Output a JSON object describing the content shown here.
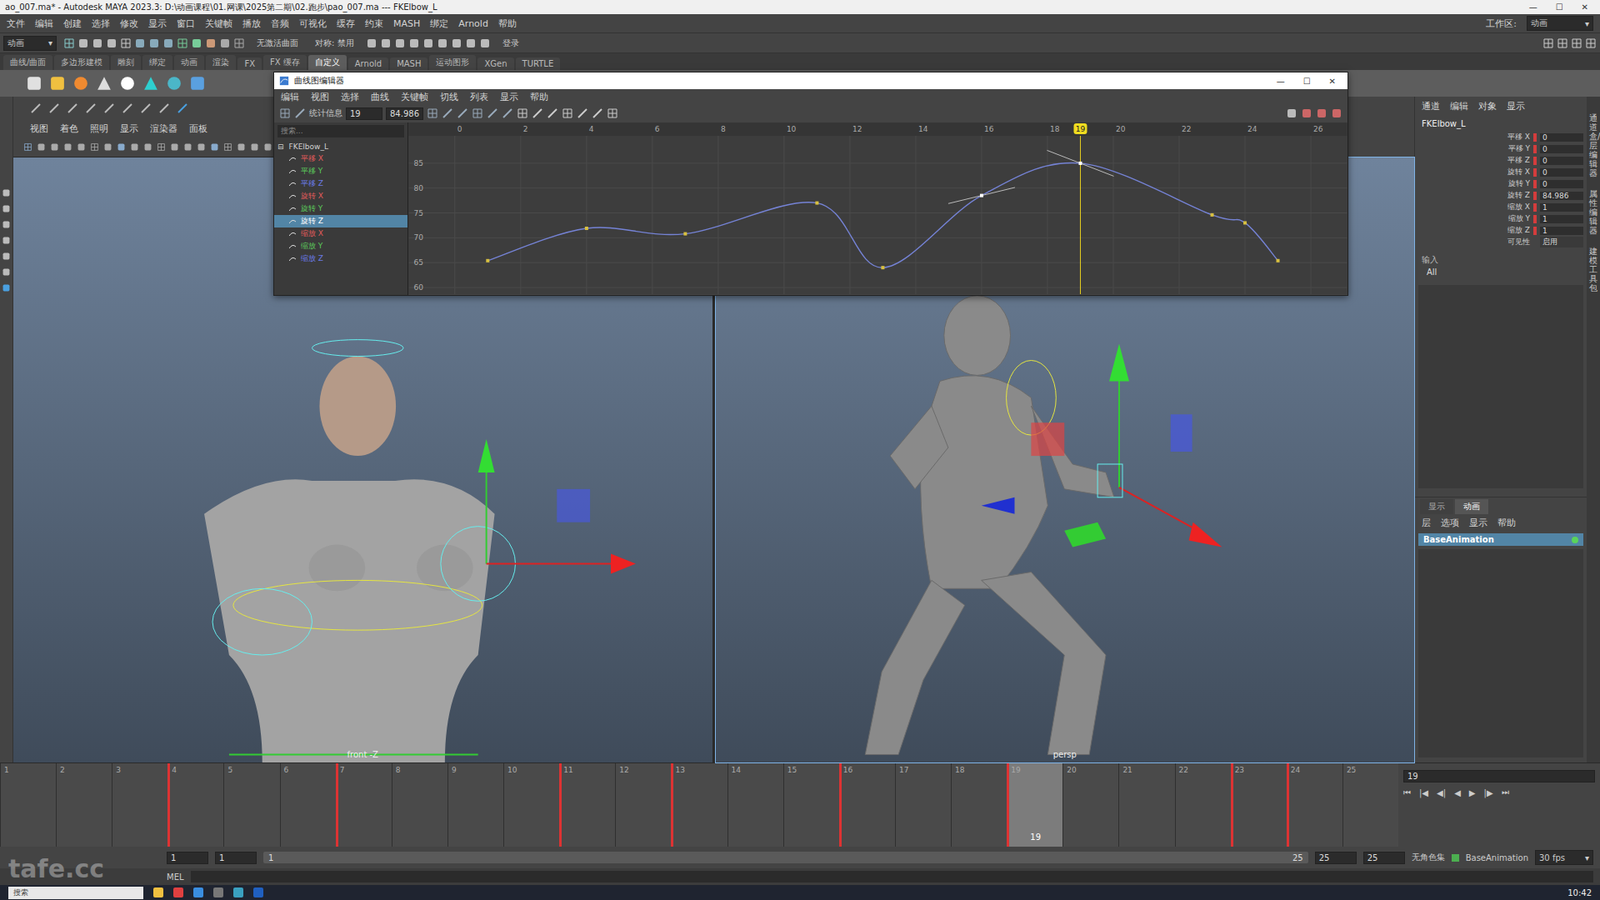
{
  "window": {
    "title": "ao_007.ma* - Autodesk MAYA 2023.3: D:\\动画课程\\01.网课\\2025第二期\\02.跑步\\pao_007.ma  ---  FKElbow_L",
    "controls": [
      "—",
      "☐",
      "✕"
    ],
    "workspace_label": "工作区:",
    "workspace": "动画"
  },
  "menu_bar": [
    "文件",
    "编辑",
    "创建",
    "选择",
    "修改",
    "显示",
    "窗口",
    "关键帧",
    "播放",
    "音频",
    "可视化",
    "缓存",
    "约束",
    "MASH",
    "绑定",
    "Arnold",
    "帮助"
  ],
  "status_line": {
    "mode": "动画",
    "surface": "无激活曲面",
    "symmetry": "对称: 禁用",
    "login": "登录"
  },
  "shelf_tabs": [
    {
      "label": "曲线/曲面",
      "selected": false
    },
    {
      "label": "多边形建模",
      "selected": false
    },
    {
      "label": "雕刻",
      "selected": false
    },
    {
      "label": "绑定",
      "selected": false
    },
    {
      "label": "动画",
      "selected": false
    },
    {
      "label": "渲染",
      "selected": false
    },
    {
      "label": "FX",
      "selected": false
    },
    {
      "label": "FX 缓存",
      "selected": false
    },
    {
      "label": "自定义",
      "selected": true
    },
    {
      "label": "Arnold",
      "selected": false
    },
    {
      "label": "MASH",
      "selected": false
    },
    {
      "label": "运动图形",
      "selected": false
    },
    {
      "label": "XGen",
      "selected": false
    },
    {
      "label": "TURTLE",
      "selected": false
    }
  ],
  "viewport_menus": [
    "视图",
    "着色",
    "照明",
    "显示",
    "渲染器",
    "面板"
  ],
  "viewports": [
    {
      "camera": "front -Z",
      "selected": false
    },
    {
      "camera": "persp",
      "selected": true
    }
  ],
  "graph_editor": {
    "title": "曲线图编辑器",
    "controls": [
      "—",
      "☐",
      "✕"
    ],
    "menus": [
      "编辑",
      "视图",
      "选择",
      "曲线",
      "关键帧",
      "切线",
      "列表",
      "显示",
      "帮助"
    ],
    "stats_label": "统计信息",
    "stats": [
      "19",
      "84.986"
    ],
    "search_placeholder": "搜索...",
    "node": "FKElbow_L",
    "node_expanded": true,
    "channels": [
      {
        "label": "平移 X",
        "color": "#e05a5a",
        "selected": false
      },
      {
        "label": "平移 Y",
        "color": "#5ac85a",
        "selected": false
      },
      {
        "label": "平移 Z",
        "color": "#6a7ae6",
        "selected": false
      },
      {
        "label": "旋转 X",
        "color": "#e05a5a",
        "selected": false
      },
      {
        "label": "旋转 Y",
        "color": "#5ac85a",
        "selected": false
      },
      {
        "label": "旋转 Z",
        "color": "#8c9cff",
        "selected": true
      },
      {
        "label": "缩放 X",
        "color": "#e05a5a",
        "selected": false
      },
      {
        "label": "缩放 Y",
        "color": "#5ac85a",
        "selected": false
      },
      {
        "label": "缩放 Z",
        "color": "#6a7ae6",
        "selected": false
      }
    ],
    "frame_ticks": [
      "0",
      "2",
      "4",
      "6",
      "8",
      "10",
      "12",
      "14",
      "16",
      "18",
      "20",
      "22",
      "24",
      "26"
    ],
    "value_ticks": [
      "85",
      "80",
      "75",
      "70",
      "65",
      "60"
    ],
    "current_frame": "19",
    "curve": {
      "color": "#7583d6",
      "frames": [
        1,
        4,
        7,
        11,
        13,
        16,
        19,
        23,
        24,
        25
      ],
      "values": [
        65.4,
        71.9,
        70.8,
        77,
        64,
        78.5,
        84.986,
        74.6,
        73,
        65.4
      ],
      "selected": [
        false,
        false,
        false,
        false,
        false,
        true,
        true,
        false,
        false,
        false
      ]
    }
  },
  "channel_box": {
    "menus": [
      "通道",
      "编辑",
      "对象",
      "显示"
    ],
    "node": "FKElbow_L",
    "attributes": [
      {
        "label": "平移 X",
        "value": "0",
        "keyed": true
      },
      {
        "label": "平移 Y",
        "value": "0",
        "keyed": true
      },
      {
        "label": "平移 Z",
        "value": "0",
        "keyed": true
      },
      {
        "label": "旋转 X",
        "value": "0",
        "keyed": true
      },
      {
        "label": "旋转 Y",
        "value": "0",
        "keyed": true
      },
      {
        "label": "旋转 Z",
        "value": "84.986",
        "keyed": true
      },
      {
        "label": "缩放 X",
        "value": "1",
        "keyed": true
      },
      {
        "label": "缩放 Y",
        "value": "1",
        "keyed": true
      },
      {
        "label": "缩放 Z",
        "value": "1",
        "keyed": true
      },
      {
        "label": "可见性",
        "value": "启用",
        "keyed": false
      }
    ],
    "inputs_label": "输入",
    "inputs": "All"
  },
  "layer_editor": {
    "tabs": [
      {
        "label": "显示",
        "selected": false
      },
      {
        "label": "动画",
        "selected": true
      }
    ],
    "menus": [
      "层",
      "选项",
      "显示",
      "帮助"
    ],
    "layers": [
      {
        "name": "BaseAnimation",
        "selected": true,
        "active": true
      }
    ]
  },
  "side_tabs": [
    "通道盒/层编辑器",
    "属性编辑器",
    "建模工具包"
  ],
  "timeline": {
    "labels": [
      "1",
      "2",
      "3",
      "4",
      "5",
      "6",
      "7",
      "8",
      "9",
      "10",
      "11",
      "12",
      "13",
      "14",
      "15",
      "16",
      "17",
      "18",
      "19",
      "20",
      "21",
      "22",
      "23",
      "24",
      "25"
    ],
    "current_frame": "19",
    "keys": [
      4,
      7,
      11,
      13,
      16,
      19,
      23,
      24
    ],
    "controls": [
      "⏮",
      "|◀",
      "◀|",
      "◀",
      "▶",
      "|▶",
      "⏭"
    ]
  },
  "range_slider": {
    "start": "1",
    "slider_start": "1",
    "slider_end": "25",
    "end": "25",
    "end2": "25",
    "character_set": "无角色集",
    "anim_layer": "BaseAnimation",
    "fps": "30 fps"
  },
  "command_line": {
    "label": "MEL"
  },
  "taskbar": {
    "search": "搜索",
    "time": "10:42"
  },
  "watermark": "tafe.cc"
}
